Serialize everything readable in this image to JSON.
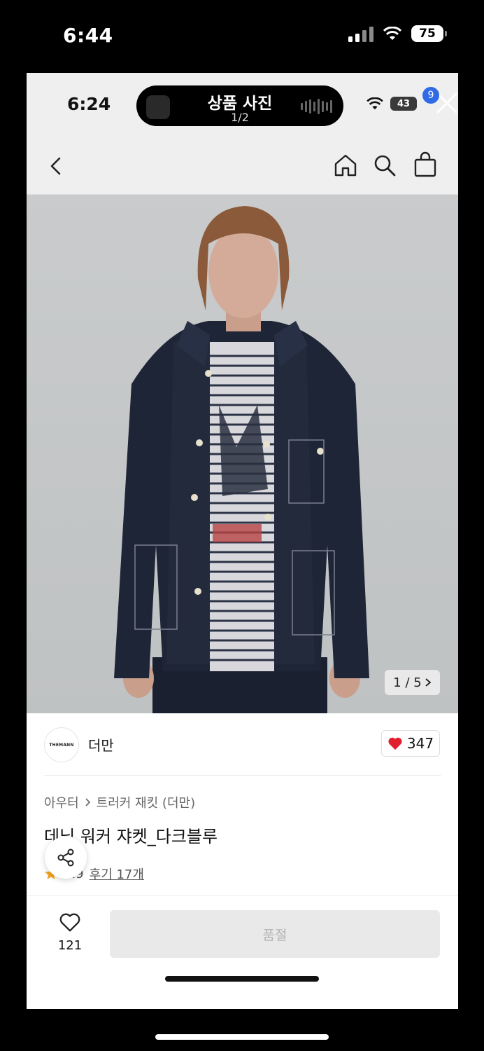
{
  "outer_status": {
    "time": "6:44",
    "battery": "75"
  },
  "inner_status": {
    "time": "6:24",
    "battery": "43"
  },
  "live_activity": {
    "title": "상품 사진",
    "subtitle": "1/2"
  },
  "nav": {
    "cart_badge": "9"
  },
  "gallery": {
    "counter": "1 / 5"
  },
  "brand": {
    "logo_text": "THEMANN",
    "name": "더만",
    "likes": "347"
  },
  "product": {
    "breadcrumb": [
      "아우터",
      "트러커 재킷 (더만)"
    ],
    "title": "데님 워커 쟈켓_다크블루",
    "rating": "4.9",
    "reviews": "후기 17개"
  },
  "bottom": {
    "wish_count": "121",
    "buy_label": "품절"
  },
  "colors": {
    "accent_blue": "#2f6be6",
    "heart_red": "#e0202e",
    "star": "#f5a623"
  },
  "icons": [
    "back-icon",
    "home-icon",
    "search-icon",
    "bag-icon",
    "close-icon",
    "share-icon",
    "heart-icon",
    "star-icon",
    "chevron-right-icon"
  ]
}
